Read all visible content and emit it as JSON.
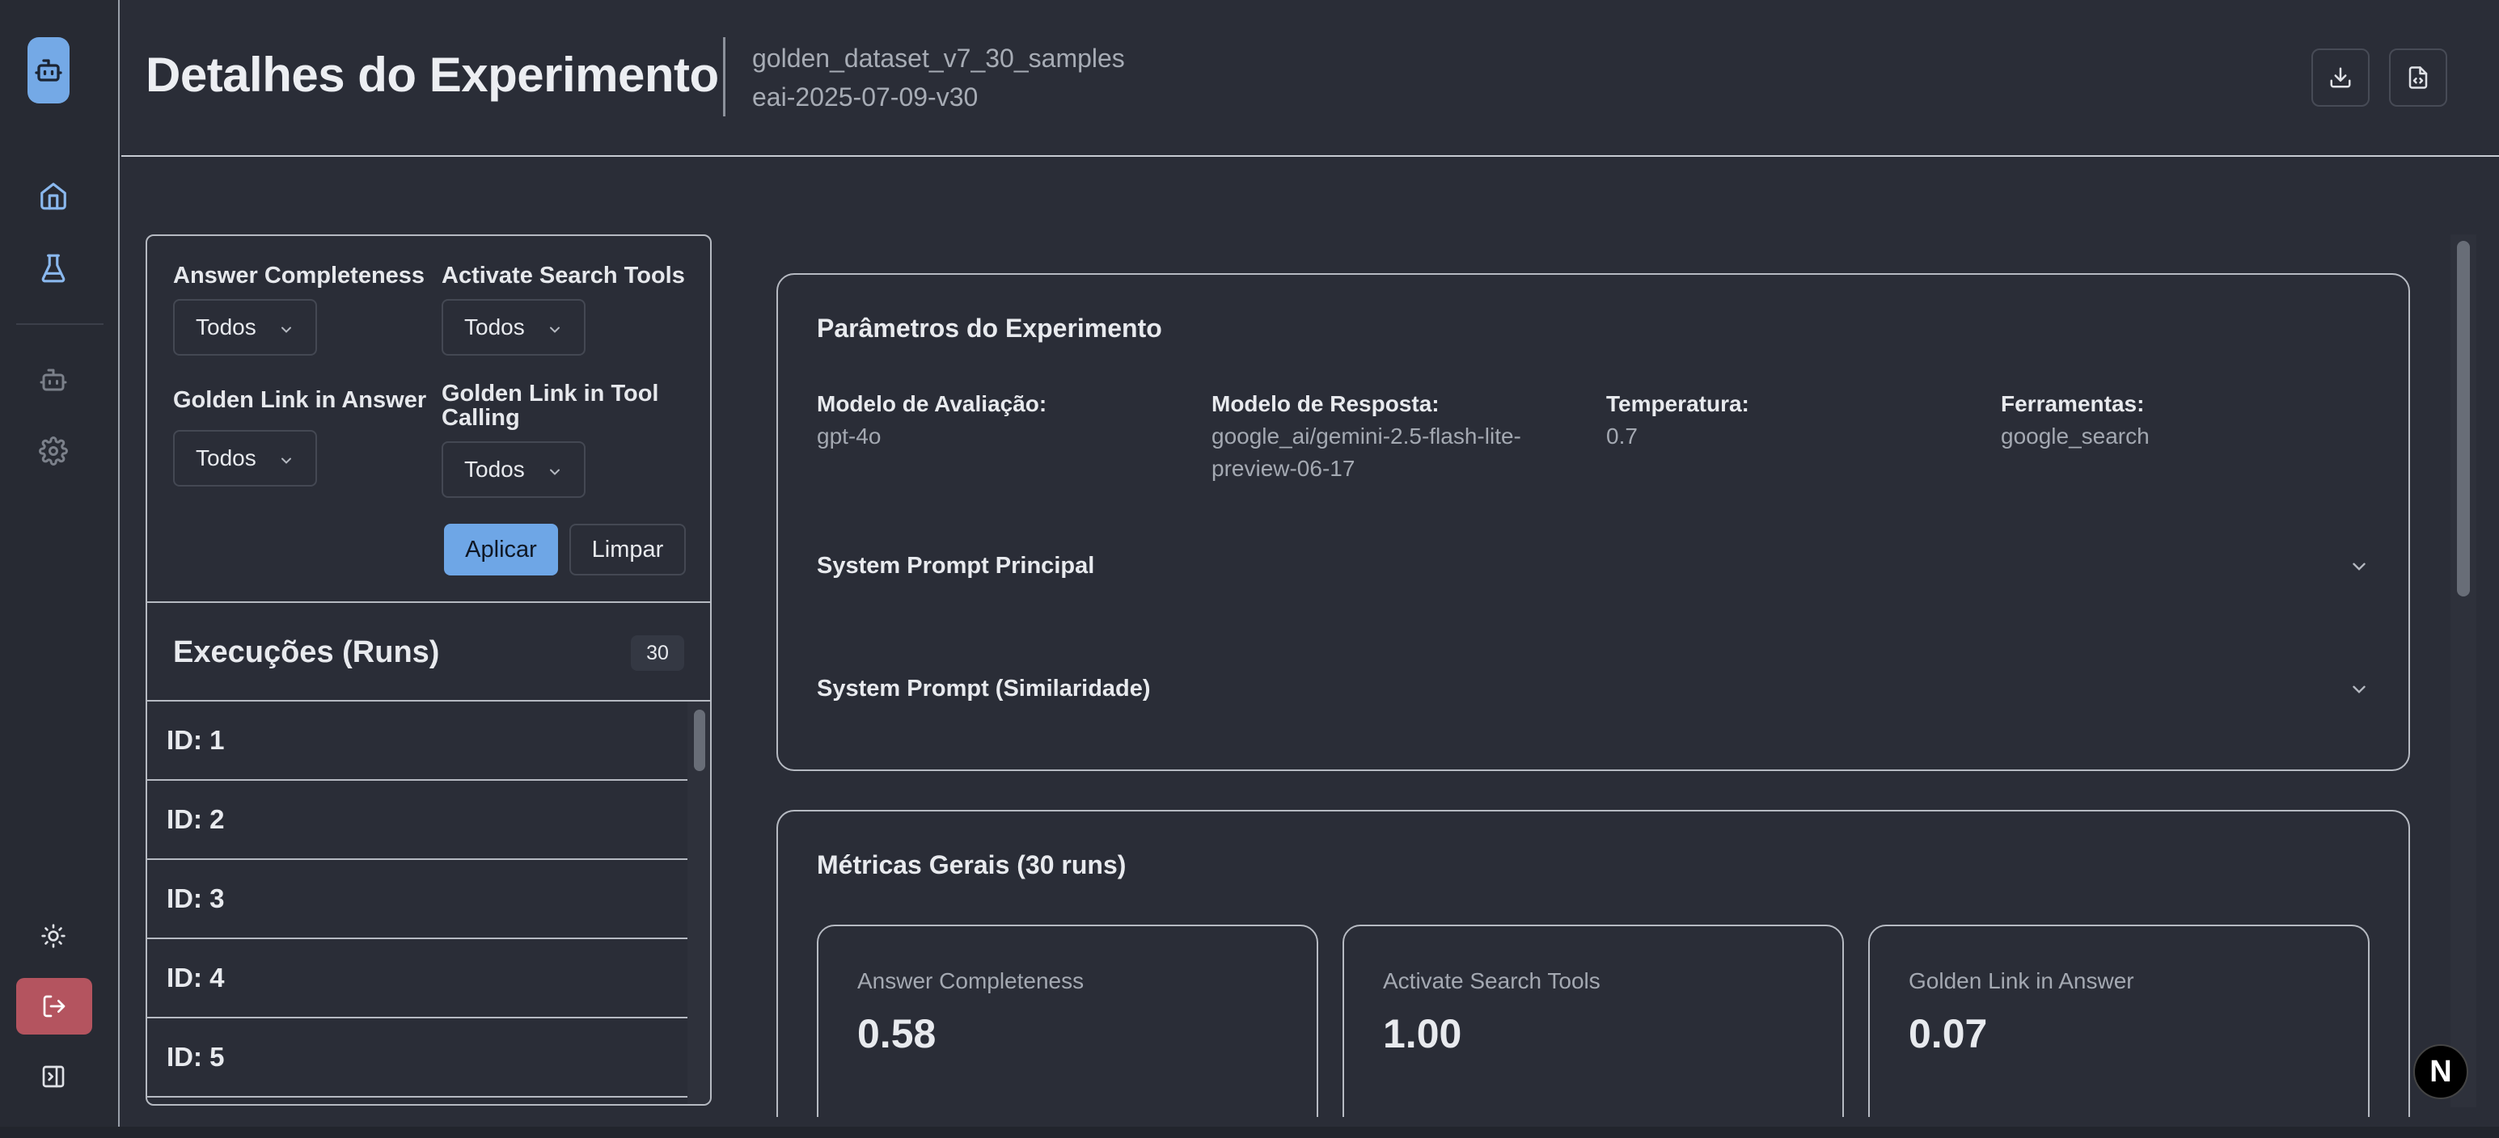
{
  "header": {
    "title": "Detalhes do Experimento",
    "dataset": "golden_dataset_v7_30_samples",
    "experiment_id": "eai-2025-07-09-v30"
  },
  "filters": {
    "answer_completeness": {
      "label": "Answer Completeness",
      "value": "Todos"
    },
    "activate_search_tools": {
      "label": "Activate Search Tools",
      "value": "Todos"
    },
    "golden_link_in_answer": {
      "label": "Golden Link in Answer",
      "value": "Todos"
    },
    "golden_link_in_tool_calling": {
      "label_line1": "Golden Link in Tool",
      "label_line2": "Calling",
      "value": "Todos"
    },
    "apply_label": "Aplicar",
    "clear_label": "Limpar"
  },
  "runs": {
    "title": "Execuções (Runs)",
    "count": "30",
    "items": [
      {
        "label": "ID: 1"
      },
      {
        "label": "ID: 2"
      },
      {
        "label": "ID: 3"
      },
      {
        "label": "ID: 4"
      },
      {
        "label": "ID: 5"
      }
    ]
  },
  "parameters": {
    "title": "Parâmetros do Experimento",
    "evaluation_model": {
      "label": "Modelo de Avaliação:",
      "value": "gpt-4o"
    },
    "response_model": {
      "label": "Modelo de Resposta:",
      "value_line1": "google_ai/gemini-2.5-flash-lite-",
      "value_line2": "preview-06-17"
    },
    "temperature": {
      "label": "Temperatura:",
      "value": "0.7"
    },
    "tools": {
      "label": "Ferramentas:",
      "value": "google_search"
    },
    "system_prompt_main": "System Prompt Principal",
    "system_prompt_similarity": "System Prompt (Similaridade)"
  },
  "metrics": {
    "title": "Métricas Gerais (30 runs)",
    "items": [
      {
        "name": "Answer Completeness",
        "value": "0.58"
      },
      {
        "name": "Activate Search Tools",
        "value": "1.00"
      },
      {
        "name": "Golden Link in Answer",
        "value": "0.07"
      }
    ]
  },
  "badge": {
    "letter": "N"
  },
  "colors": {
    "accent": "#6ea6e6",
    "logout": "#b4545f",
    "background": "#2a2d37"
  }
}
